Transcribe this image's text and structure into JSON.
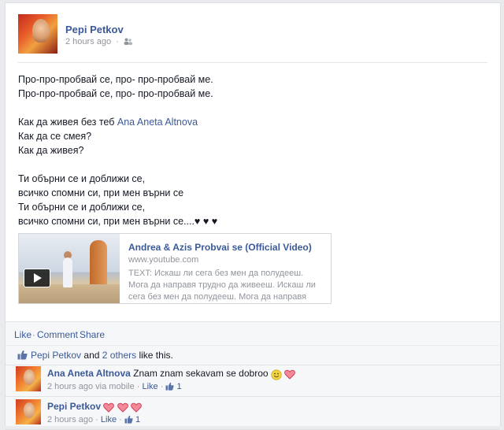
{
  "post": {
    "author": "Pepi Petkov",
    "timestamp": "2 hours ago",
    "meta_separator": "·",
    "audience_icon": "friends-icon",
    "lines": [
      "Про-про-пробвай се, про- про-пробвай ме.",
      "Про-про-пробвай се, про- про-пробвай ме.",
      "",
      "Как да живея без теб",
      "Как да се смея?",
      "Как да живея?",
      "",
      "Ти обърни се и доближи се,",
      "всичко спомни си, при мен върни се",
      "Ти обърни се и доближи се,",
      "всичко спомни си, при мен върни се....♥ ♥ ♥"
    ],
    "tagged_person": "Ana Aneta Altnova"
  },
  "link_preview": {
    "title": "Andrea & Azis Probvai se (Official Video)",
    "domain": "www.youtube.com",
    "description": "TEXT: Искаш ли сега без мен да полудееш. Мога да направя трудно да живееш. Искаш ли сега без мен да полудееш. Мога да направя трудно",
    "play_icon": "play-icon"
  },
  "actions": {
    "like": "Like",
    "comment": "Comment",
    "share": "Share",
    "separator": "·"
  },
  "likes_summary": {
    "name": "Pepi Petkov",
    "connector": "and",
    "others": "2 others",
    "suffix": "like this."
  },
  "comments": [
    {
      "author": "Ana Aneta Altnova",
      "text": "Znam znam sekavam se dobroo",
      "emoticons": [
        "smiley",
        "heart"
      ],
      "timestamp": "2 hours ago",
      "via": "via mobile",
      "like_label": "Like",
      "like_count": "1",
      "separator": "·"
    },
    {
      "author": "Pepi Petkov",
      "text": "",
      "emoticons": [
        "heart",
        "heart",
        "heart"
      ],
      "timestamp": "2 hours ago",
      "like_label": "Like",
      "like_count": "1",
      "separator": "·"
    }
  ],
  "colors": {
    "link": "#3b5998",
    "meta": "#90949c",
    "heart": "#e0314a",
    "ufi_bg": "#f6f7f9"
  }
}
